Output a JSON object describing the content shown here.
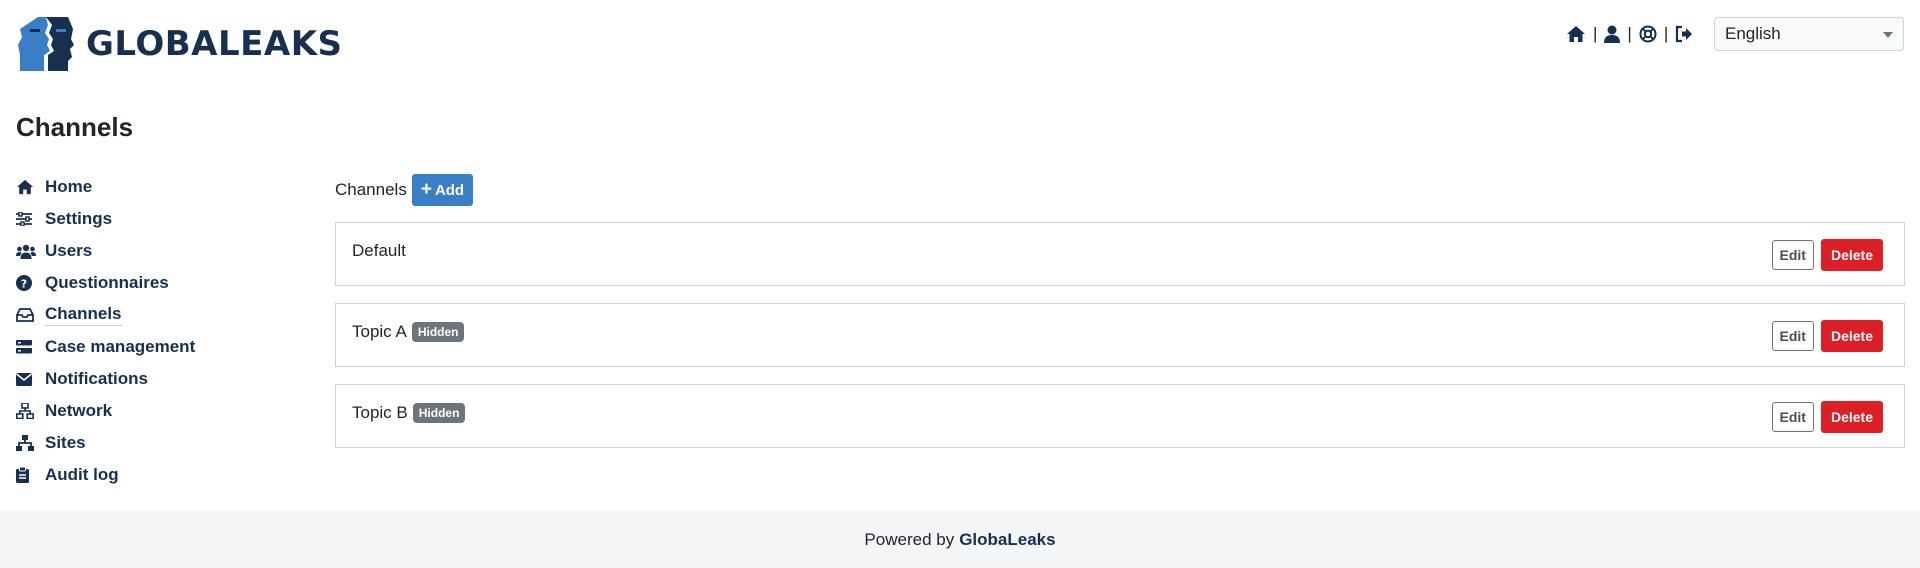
{
  "brand": {
    "name": "GLOBALEAKS"
  },
  "header": {
    "icons": [
      "home-icon",
      "user-icon",
      "support-icon",
      "logout-icon"
    ],
    "separator": "|",
    "language": "English"
  },
  "page": {
    "title": "Channels"
  },
  "sidebar": {
    "active": "Channels",
    "items": [
      {
        "label": "Home",
        "icon": "home-icon"
      },
      {
        "label": "Settings",
        "icon": "sliders-icon"
      },
      {
        "label": "Users",
        "icon": "users-icon"
      },
      {
        "label": "Questionnaires",
        "icon": "question-circle-icon"
      },
      {
        "label": "Channels",
        "icon": "inbox-icon"
      },
      {
        "label": "Case management",
        "icon": "cases-icon"
      },
      {
        "label": "Notifications",
        "icon": "envelope-icon"
      },
      {
        "label": "Network",
        "icon": "network-icon"
      },
      {
        "label": "Sites",
        "icon": "sitemap-icon"
      },
      {
        "label": "Audit log",
        "icon": "clipboard-icon"
      }
    ]
  },
  "main": {
    "section_label": "Channels",
    "add_label": "Add",
    "edit_label": "Edit",
    "delete_label": "Delete",
    "channels": [
      {
        "name": "Default",
        "badge": ""
      },
      {
        "name": "Topic A",
        "badge": "Hidden"
      },
      {
        "name": "Topic B",
        "badge": "Hidden"
      }
    ]
  },
  "footer": {
    "prefix": "Powered by",
    "brand": "GlobaLeaks"
  },
  "colors": {
    "brand": "#18304f",
    "logo_blue": "#3a7fc6",
    "add_button": "#3a7fc6",
    "delete_button": "#dc1f26",
    "badge": "#6c757d",
    "footer_bg": "#f4f5f7"
  }
}
